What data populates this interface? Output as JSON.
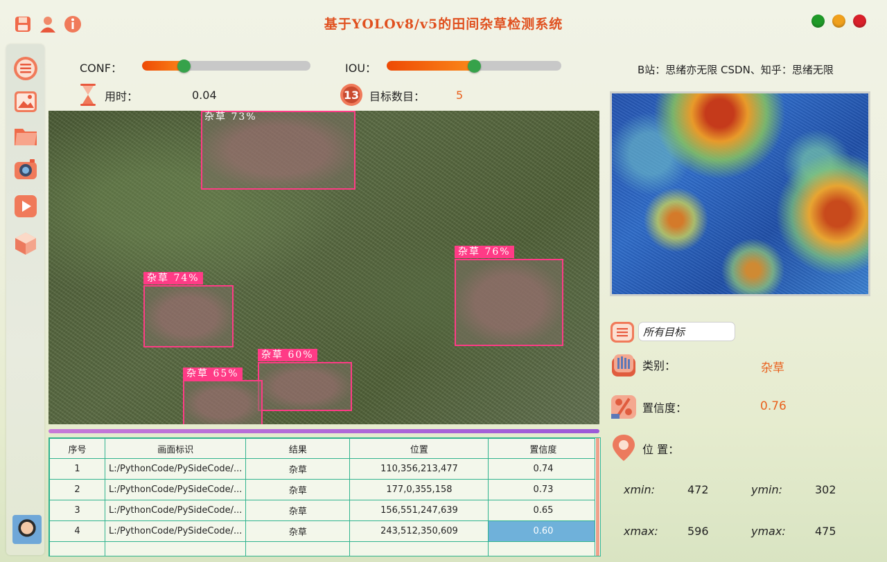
{
  "window": {
    "title": "基于YOLOv8/v5的田间杂草检测系统",
    "controls": {
      "close_color": "#d9202a",
      "minimize_color": "#f0a01c",
      "maximize_color": "#1f9a28"
    }
  },
  "toolbar": {
    "icons": [
      "save-icon",
      "user-icon",
      "info-icon"
    ]
  },
  "sidebar": {
    "items": [
      "menu-icon",
      "image-icon",
      "folder-icon",
      "camera-icon",
      "video-play-icon",
      "model-cube-icon"
    ],
    "avatar": "avatar"
  },
  "controls": {
    "conf_label": "CONF：",
    "conf_value": 0.25,
    "iou_label": "IOU：",
    "iou_value": 0.5,
    "time_label": "用时：",
    "time_value": "0.04",
    "count_label": "目标数目：",
    "count_value": "5"
  },
  "detections": [
    {
      "label": "杂草  73%"
    },
    {
      "label": "杂草  76%"
    },
    {
      "label": "杂草  74%"
    },
    {
      "label": "杂草  60%"
    },
    {
      "label": "杂草  65%"
    }
  ],
  "table": {
    "headers": [
      "序号",
      "画面标识",
      "结果",
      "位置",
      "置信度"
    ],
    "rows": [
      [
        "1",
        "L:/PythonCode/PySideCode/...",
        "杂草",
        "110,356,213,477",
        "0.74"
      ],
      [
        "2",
        "L:/PythonCode/PySideCode/...",
        "杂草",
        "177,0,355,158",
        "0.73"
      ],
      [
        "3",
        "L:/PythonCode/PySideCode/...",
        "杂草",
        "156,551,247,639",
        "0.65"
      ],
      [
        "4",
        "L:/PythonCode/PySideCode/...",
        "杂草",
        "243,512,350,609",
        "0.60"
      ]
    ],
    "selected_row": 3
  },
  "right_panel": {
    "credit": "B站：思绪亦无限  CSDN、知乎：思绪无限",
    "target_select": "所有目标",
    "class_label": "类别：",
    "class_value": "杂草",
    "conf_label": "置信度：",
    "conf_value": "0.76",
    "pos_label": "位 置：",
    "xmin_label": "xmin:",
    "xmin_value": "472",
    "ymin_label": "ymin:",
    "ymin_value": "302",
    "xmax_label": "xmax:",
    "xmax_value": "596",
    "ymax_label": "ymax:",
    "ymax_value": "475"
  }
}
